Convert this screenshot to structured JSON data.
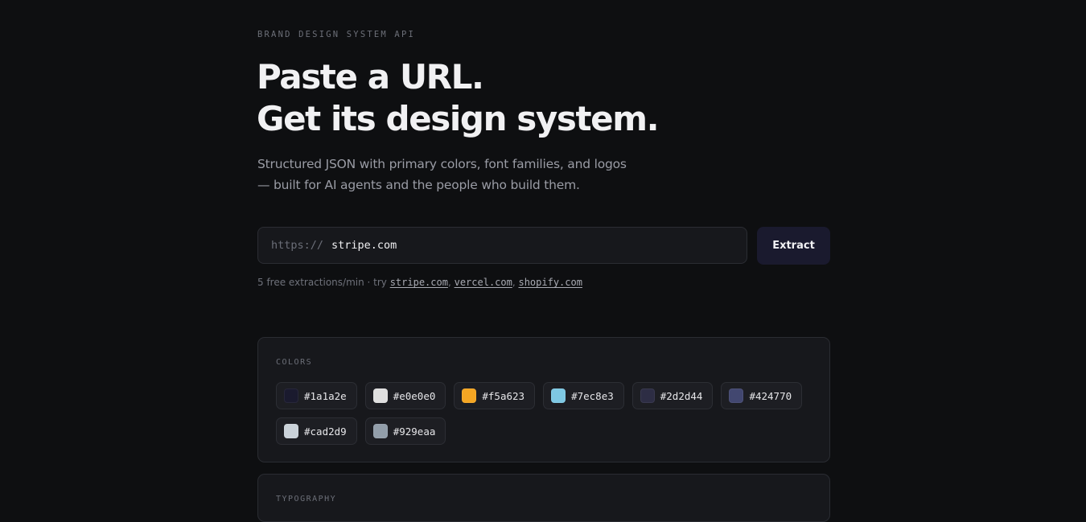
{
  "header": {
    "eyebrow": "BRAND DESIGN SYSTEM API",
    "headline_line1": "Paste a URL.",
    "headline_line2": "Get its design system.",
    "subtitle_line1": "Structured JSON with primary colors, font families, and logos",
    "subtitle_line2": "— built for AI agents and the people who build them."
  },
  "form": {
    "url_prefix": "https://",
    "url_value": "stripe.com",
    "extract_label": "Extract"
  },
  "hint": {
    "prefix": "5 free extractions/min · try ",
    "examples": [
      "stripe.com",
      "vercel.com",
      "shopify.com"
    ],
    "separator": ", "
  },
  "colors_section": {
    "label": "COLORS",
    "colors": [
      {
        "hex": "#1a1a2e",
        "color": "#1a1a2e"
      },
      {
        "hex": "#e0e0e0",
        "color": "#e0e0e0"
      },
      {
        "hex": "#f5a623",
        "color": "#f5a623"
      },
      {
        "hex": "#7ec8e3",
        "color": "#7ec8e3"
      },
      {
        "hex": "#2d2d44",
        "color": "#2d2d44"
      },
      {
        "hex": "#424770",
        "color": "#424770"
      },
      {
        "hex": "#cad2d9",
        "color": "#cad2d9"
      },
      {
        "hex": "#929eaa",
        "color": "#929eaa"
      }
    ]
  },
  "typography_section": {
    "label": "TYPOGRAPHY"
  },
  "theme": {
    "background": "#0e0f11",
    "card_background": "#17181c",
    "button_background": "#1a1a2e"
  }
}
